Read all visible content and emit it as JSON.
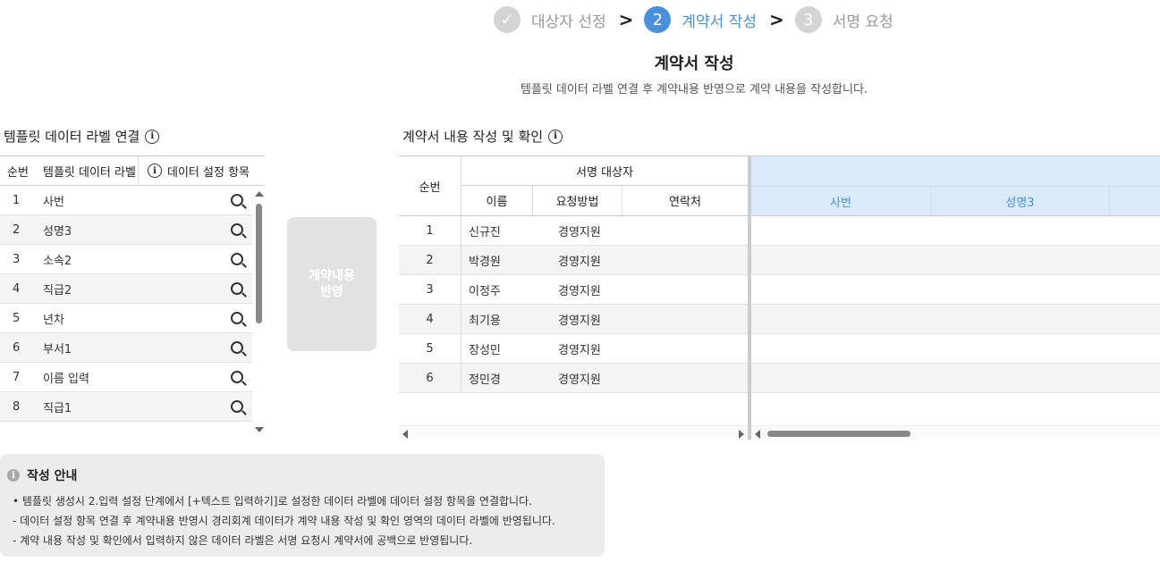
{
  "stepper": {
    "steps": [
      {
        "num": "✓",
        "label": "대상자 선정",
        "state": "done"
      },
      {
        "num": "2",
        "label": "계약서 작성",
        "state": "active"
      },
      {
        "num": "3",
        "label": "서명 요청",
        "state": "todo"
      }
    ],
    "separator": ">"
  },
  "page": {
    "title": "계약서 작성",
    "subtitle": "템플릿 데이터 라벨 연결 후 계약내용 반영으로 계약 내용을 작성합니다."
  },
  "left": {
    "section_title": "템플릿 데이터 라벨 연결",
    "headers": {
      "no": "순번",
      "label": "템플릿 데이터 라벨",
      "item": "데이터 설정 항목"
    },
    "rows": [
      {
        "no": "1",
        "label": "사번"
      },
      {
        "no": "2",
        "label": "성명3"
      },
      {
        "no": "3",
        "label": "소속2"
      },
      {
        "no": "4",
        "label": "직급2"
      },
      {
        "no": "5",
        "label": "년차"
      },
      {
        "no": "6",
        "label": "부서1"
      },
      {
        "no": "7",
        "label": "이름 입력"
      },
      {
        "no": "8",
        "label": "직급1"
      }
    ]
  },
  "apply_button": {
    "line1": "계약내용",
    "line2": "반영"
  },
  "right": {
    "section_title": "계약서 내용 작성 및 확인",
    "headers": {
      "no": "순번",
      "group": "서명 대상자",
      "name": "이름",
      "method": "요청방법",
      "contact": "연락처"
    },
    "data_columns": [
      "사번",
      "성명3",
      ""
    ],
    "rows": [
      {
        "no": "1",
        "name": "신규진",
        "method": "경영지원",
        "contact": ""
      },
      {
        "no": "2",
        "name": "박경원",
        "method": "경영지원",
        "contact": ""
      },
      {
        "no": "3",
        "name": "이정주",
        "method": "경영지원",
        "contact": ""
      },
      {
        "no": "4",
        "name": "최기용",
        "method": "경영지원",
        "contact": ""
      },
      {
        "no": "5",
        "name": "장성민",
        "method": "경영지원",
        "contact": ""
      },
      {
        "no": "6",
        "name": "정민경",
        "method": "경영지원",
        "contact": ""
      }
    ]
  },
  "guide": {
    "title": "작성 안내",
    "lines": [
      "• 템플릿 생성시 2.입력 설정 단계에서 [+텍스트 입력하기]로 설정한 데이터 라벨에 데이터 설정 항목을 연결합니다.",
      "- 데이터 설정 항목 연결 후 계약내용 반영시 경리회계 데이터가 계약 내용 작성 및 확인 영역의 데이터 라벨에 반영됩니다.",
      "- 계약 내용 작성 및 확인에서 입력하지 않은 데이터 라벨은 서명 요청시 계약서에 공백으로 반영됩니다."
    ]
  },
  "colors": {
    "accent": "#4a90d9",
    "header_highlight": "#dbeaf8",
    "inactive": "#d4d4d4"
  }
}
